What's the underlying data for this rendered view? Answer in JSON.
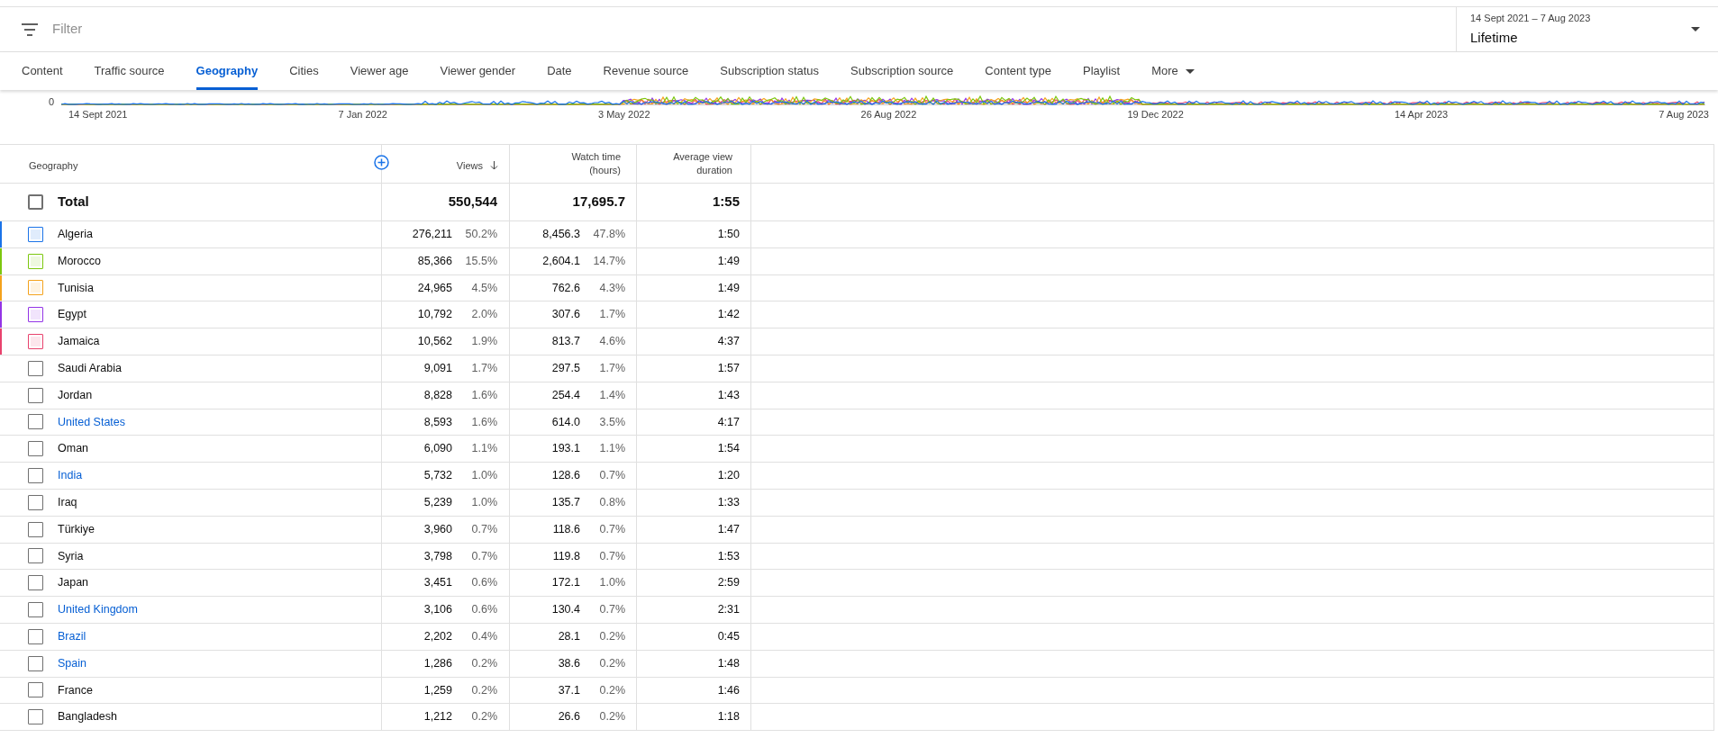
{
  "filter": {
    "placeholder": "Filter"
  },
  "date_range": {
    "range": "14 Sept 2021 – 7 Aug 2023",
    "value": "Lifetime"
  },
  "tabs": [
    {
      "label": "Content",
      "selected": false
    },
    {
      "label": "Traffic source",
      "selected": false
    },
    {
      "label": "Geography",
      "selected": true
    },
    {
      "label": "Cities",
      "selected": false
    },
    {
      "label": "Viewer age",
      "selected": false
    },
    {
      "label": "Viewer gender",
      "selected": false
    },
    {
      "label": "Date",
      "selected": false
    },
    {
      "label": "Revenue source",
      "selected": false
    },
    {
      "label": "Subscription status",
      "selected": false
    },
    {
      "label": "Subscription source",
      "selected": false
    },
    {
      "label": "Content type",
      "selected": false
    },
    {
      "label": "Playlist",
      "selected": false
    },
    {
      "label": "More",
      "selected": false,
      "kind": "menu"
    }
  ],
  "chart": {
    "y_label": "0",
    "x_labels": [
      "14 Sept 2021",
      "7 Jan 2022",
      "3 May 2022",
      "26 Aug 2022",
      "19 Dec 2022",
      "14 Apr 2023",
      "7 Aug 2023"
    ]
  },
  "table": {
    "columns": [
      {
        "label": "Geography"
      },
      {
        "label": "Views",
        "sorted": true
      },
      {
        "label": "Watch time (hours)"
      },
      {
        "label": "Average view duration"
      }
    ],
    "total": {
      "label": "Total",
      "checked": false,
      "views": "550,544",
      "watch_time": "17,695.7",
      "avg_duration": "1:55"
    },
    "rows": [
      {
        "name": "Algeria",
        "link": false,
        "selected": true,
        "color": "#1a73e8",
        "views": "276,211",
        "views_pct": "50.2%",
        "watch_time": "8,456.3",
        "watch_pct": "47.8%",
        "avg_duration": "1:50"
      },
      {
        "name": "Morocco",
        "link": false,
        "selected": true,
        "color": "#7cc70e",
        "views": "85,366",
        "views_pct": "15.5%",
        "watch_time": "2,604.1",
        "watch_pct": "14.7%",
        "avg_duration": "1:49"
      },
      {
        "name": "Tunisia",
        "link": false,
        "selected": true,
        "color": "#f4a21c",
        "views": "24,965",
        "views_pct": "4.5%",
        "watch_time": "762.6",
        "watch_pct": "4.3%",
        "avg_duration": "1:49"
      },
      {
        "name": "Egypt",
        "link": false,
        "selected": true,
        "color": "#9334e6",
        "views": "10,792",
        "views_pct": "2.0%",
        "watch_time": "307.6",
        "watch_pct": "1.7%",
        "avg_duration": "1:42"
      },
      {
        "name": "Jamaica",
        "link": false,
        "selected": true,
        "color": "#e8426d",
        "views": "10,562",
        "views_pct": "1.9%",
        "watch_time": "813.7",
        "watch_pct": "4.6%",
        "avg_duration": "4:37"
      },
      {
        "name": "Saudi Arabia",
        "link": false,
        "selected": false,
        "views": "9,091",
        "views_pct": "1.7%",
        "watch_time": "297.5",
        "watch_pct": "1.7%",
        "avg_duration": "1:57"
      },
      {
        "name": "Jordan",
        "link": false,
        "selected": false,
        "views": "8,828",
        "views_pct": "1.6%",
        "watch_time": "254.4",
        "watch_pct": "1.4%",
        "avg_duration": "1:43"
      },
      {
        "name": "United States",
        "link": true,
        "selected": false,
        "views": "8,593",
        "views_pct": "1.6%",
        "watch_time": "614.0",
        "watch_pct": "3.5%",
        "avg_duration": "4:17"
      },
      {
        "name": "Oman",
        "link": false,
        "selected": false,
        "views": "6,090",
        "views_pct": "1.1%",
        "watch_time": "193.1",
        "watch_pct": "1.1%",
        "avg_duration": "1:54"
      },
      {
        "name": "India",
        "link": true,
        "selected": false,
        "views": "5,732",
        "views_pct": "1.0%",
        "watch_time": "128.6",
        "watch_pct": "0.7%",
        "avg_duration": "1:20"
      },
      {
        "name": "Iraq",
        "link": false,
        "selected": false,
        "views": "5,239",
        "views_pct": "1.0%",
        "watch_time": "135.7",
        "watch_pct": "0.8%",
        "avg_duration": "1:33"
      },
      {
        "name": "Türkiye",
        "link": false,
        "selected": false,
        "views": "3,960",
        "views_pct": "0.7%",
        "watch_time": "118.6",
        "watch_pct": "0.7%",
        "avg_duration": "1:47"
      },
      {
        "name": "Syria",
        "link": false,
        "selected": false,
        "views": "3,798",
        "views_pct": "0.7%",
        "watch_time": "119.8",
        "watch_pct": "0.7%",
        "avg_duration": "1:53"
      },
      {
        "name": "Japan",
        "link": false,
        "selected": false,
        "views": "3,451",
        "views_pct": "0.6%",
        "watch_time": "172.1",
        "watch_pct": "1.0%",
        "avg_duration": "2:59"
      },
      {
        "name": "United Kingdom",
        "link": true,
        "selected": false,
        "views": "3,106",
        "views_pct": "0.6%",
        "watch_time": "130.4",
        "watch_pct": "0.7%",
        "avg_duration": "2:31"
      },
      {
        "name": "Brazil",
        "link": true,
        "selected": false,
        "views": "2,202",
        "views_pct": "0.4%",
        "watch_time": "28.1",
        "watch_pct": "0.2%",
        "avg_duration": "0:45"
      },
      {
        "name": "Spain",
        "link": true,
        "selected": false,
        "views": "1,286",
        "views_pct": "0.2%",
        "watch_time": "38.6",
        "watch_pct": "0.2%",
        "avg_duration": "1:48"
      },
      {
        "name": "France",
        "link": false,
        "selected": false,
        "views": "1,259",
        "views_pct": "0.2%",
        "watch_time": "37.1",
        "watch_pct": "0.2%",
        "avg_duration": "1:46"
      },
      {
        "name": "Bangladesh",
        "link": false,
        "selected": false,
        "views": "1,212",
        "views_pct": "0.2%",
        "watch_time": "26.6",
        "watch_pct": "0.2%",
        "avg_duration": "1:18"
      }
    ]
  }
}
